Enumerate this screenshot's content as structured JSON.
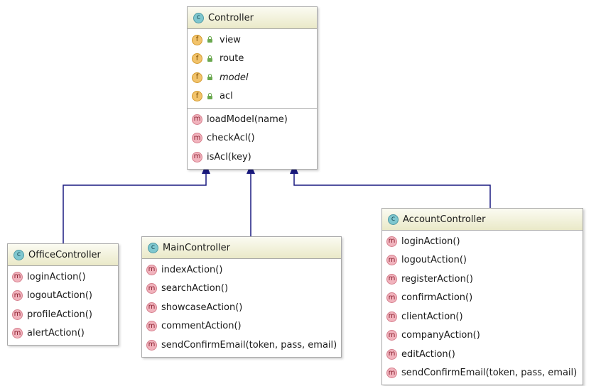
{
  "diagram": {
    "classes": {
      "controller": {
        "name": "Controller",
        "kind_badge": "c",
        "fields": [
          {
            "badge": "f",
            "name": "view"
          },
          {
            "badge": "f",
            "name": "route"
          },
          {
            "badge": "f",
            "name": "model"
          },
          {
            "badge": "f",
            "name": "acl"
          }
        ],
        "methods": [
          {
            "badge": "m",
            "name": "loadModel(name)"
          },
          {
            "badge": "m",
            "name": "checkAcl()"
          },
          {
            "badge": "m",
            "name": "isAcl(key)"
          }
        ]
      },
      "office": {
        "name": "OfficeController",
        "kind_badge": "c",
        "methods": [
          {
            "badge": "m",
            "name": "loginAction()"
          },
          {
            "badge": "m",
            "name": "logoutAction()"
          },
          {
            "badge": "m",
            "name": "profileAction()"
          },
          {
            "badge": "m",
            "name": "alertAction()"
          }
        ]
      },
      "main": {
        "name": "MainController",
        "kind_badge": "c",
        "methods": [
          {
            "badge": "m",
            "name": "indexAction()"
          },
          {
            "badge": "m",
            "name": "searchAction()"
          },
          {
            "badge": "m",
            "name": "showcaseAction()"
          },
          {
            "badge": "m",
            "name": "commentAction()"
          },
          {
            "badge": "m",
            "name": "sendConfirmEmail(token, pass, email)"
          }
        ]
      },
      "account": {
        "name": "AccountController",
        "kind_badge": "c",
        "methods": [
          {
            "badge": "m",
            "name": "loginAction()"
          },
          {
            "badge": "m",
            "name": "logoutAction()"
          },
          {
            "badge": "m",
            "name": "registerAction()"
          },
          {
            "badge": "m",
            "name": "confirmAction()"
          },
          {
            "badge": "m",
            "name": "clientAction()"
          },
          {
            "badge": "m",
            "name": "companyAction()"
          },
          {
            "badge": "m",
            "name": "editAction()"
          },
          {
            "badge": "m",
            "name": "sendConfirmEmail(token, pass, email)"
          }
        ]
      }
    },
    "colors": {
      "arrow": "#1a1a80",
      "class_badge": "#7fc7cf",
      "field_badge": "#f2c36b",
      "method_badge": "#f1b3bd",
      "header_bg": "#eae9c8"
    }
  }
}
